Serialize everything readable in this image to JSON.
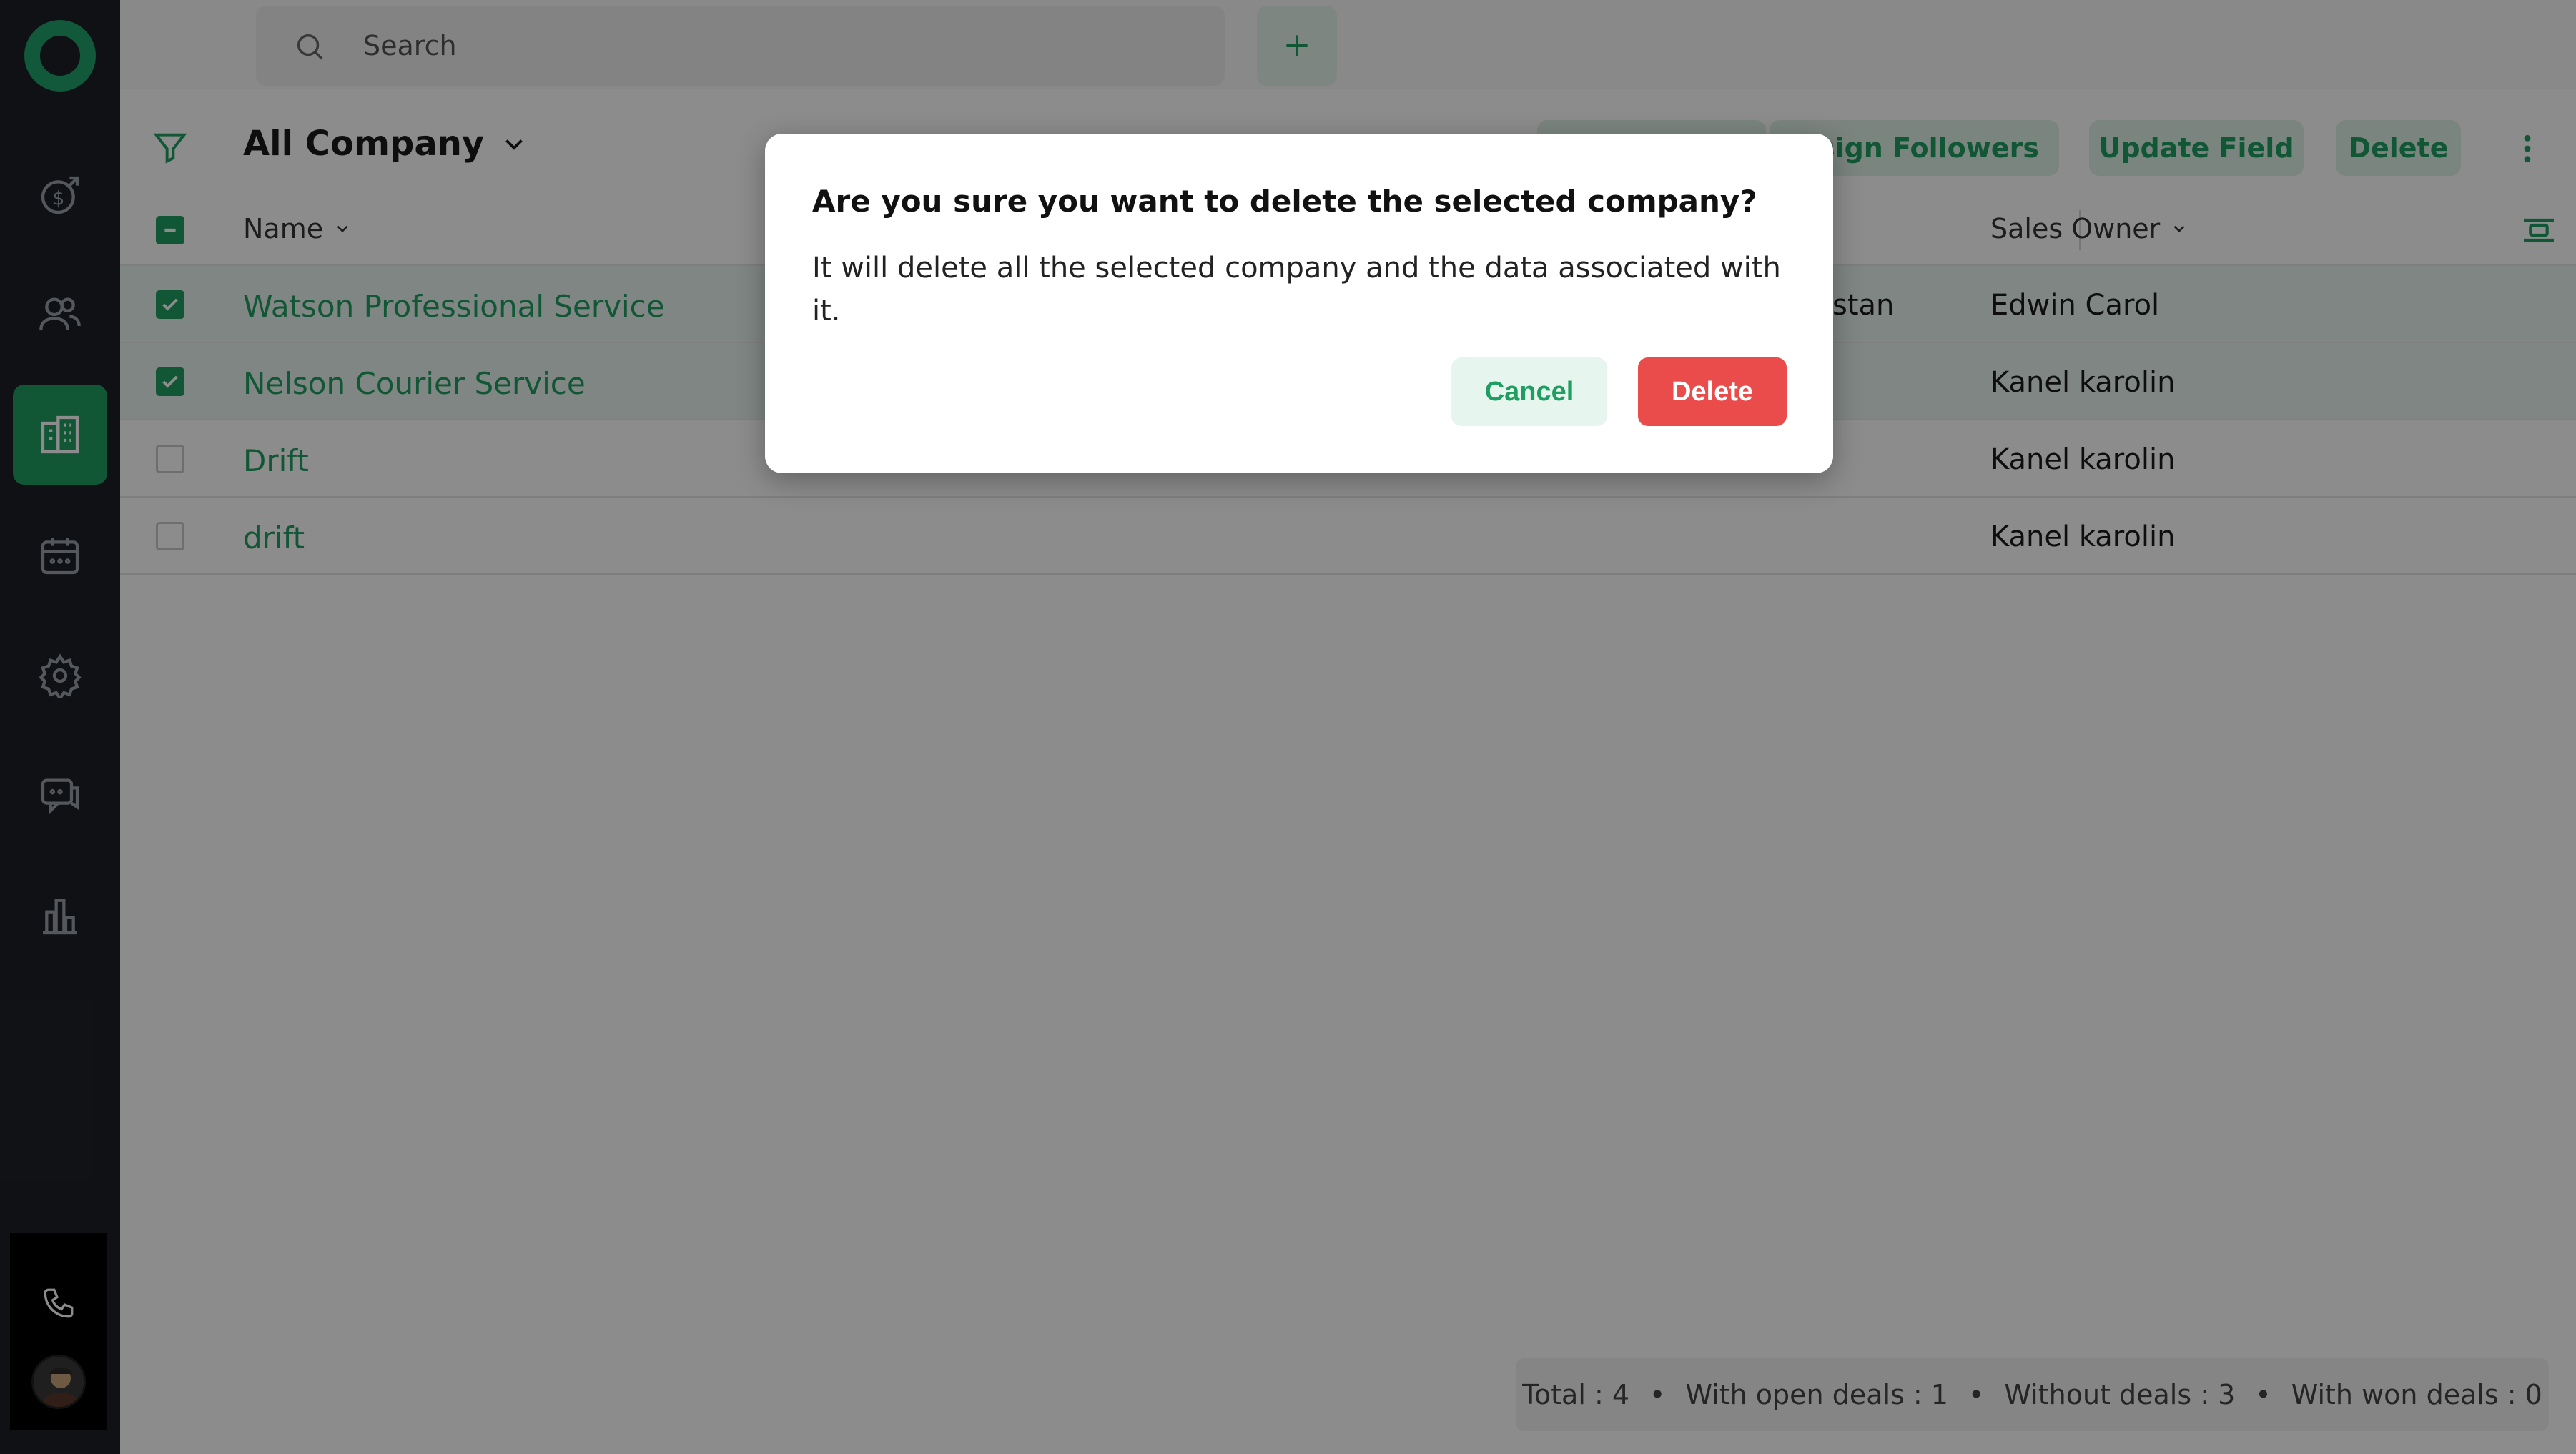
{
  "topbar": {
    "search_placeholder": "Search"
  },
  "view": {
    "title": "All Company"
  },
  "toolbar": {
    "assign_followers": "ssign Followers",
    "update_field": "Update Field",
    "delete": "Delete"
  },
  "table": {
    "columns": {
      "name": "Name",
      "sales_owner": "Sales Owner"
    },
    "rows": [
      {
        "name": "Watson Professional Service",
        "partial": "stan",
        "owner": "Edwin Carol",
        "checked": true
      },
      {
        "name": "Nelson Courier Service",
        "owner": "Kanel karolin",
        "checked": true
      },
      {
        "name": "Drift",
        "owner": "Kanel karolin",
        "checked": false
      },
      {
        "name": "drift",
        "owner": "Kanel karolin",
        "checked": false
      }
    ]
  },
  "footer": {
    "total": "Total : 4",
    "open_deals": "With open deals : 1",
    "without_deals": "Without deals : 3",
    "won_deals": "With won deals : 0"
  },
  "modal": {
    "title": "Are you sure you want to delete the selected company?",
    "body": "It will delete all the selected company and the data associated with it.",
    "cancel": "Cancel",
    "delete": "Delete"
  },
  "colors": {
    "accent": "#1f9e62",
    "danger": "#ea4b4b",
    "sidebar": "#1d2027"
  },
  "icons": [
    "logo",
    "deals-icon",
    "contacts-icon",
    "company-icon",
    "calendar-icon",
    "settings-icon",
    "chat-icon",
    "reports-icon",
    "phone-icon",
    "search-icon",
    "plus-icon",
    "bell-icon",
    "filter-icon",
    "chevron-down-icon",
    "kebab-icon",
    "column-settings-icon"
  ]
}
